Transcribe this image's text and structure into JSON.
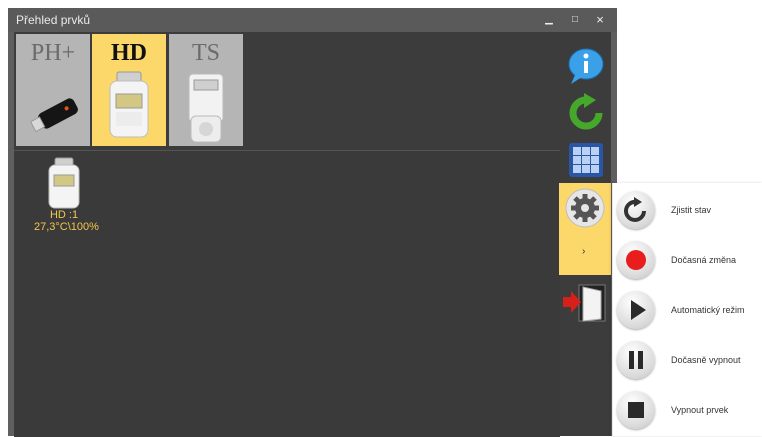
{
  "window": {
    "title": "Přehled prvků",
    "minimize": "▁",
    "maximize": "□",
    "close": "×"
  },
  "tabs": [
    {
      "label": "PH+"
    },
    {
      "label": "HD"
    },
    {
      "label": "TS"
    }
  ],
  "device": {
    "name": "HD :1",
    "status": "27,3°C\\100%"
  },
  "colors": {
    "active_tab": "#fcd86a",
    "device_text": "#f4c64a",
    "stop_red": "#e81e1e"
  },
  "gear_panel": {
    "arrow": "›"
  },
  "menu": {
    "items": [
      {
        "label": "Zjistit stav",
        "icon": "refresh-icon"
      },
      {
        "label": "Dočasná změna",
        "icon": "record-icon"
      },
      {
        "label": "Automatický režim",
        "icon": "play-icon"
      },
      {
        "label": "Dočasně vypnout",
        "icon": "pause-icon"
      },
      {
        "label": "Vypnout prvek",
        "icon": "stop-icon"
      }
    ]
  }
}
